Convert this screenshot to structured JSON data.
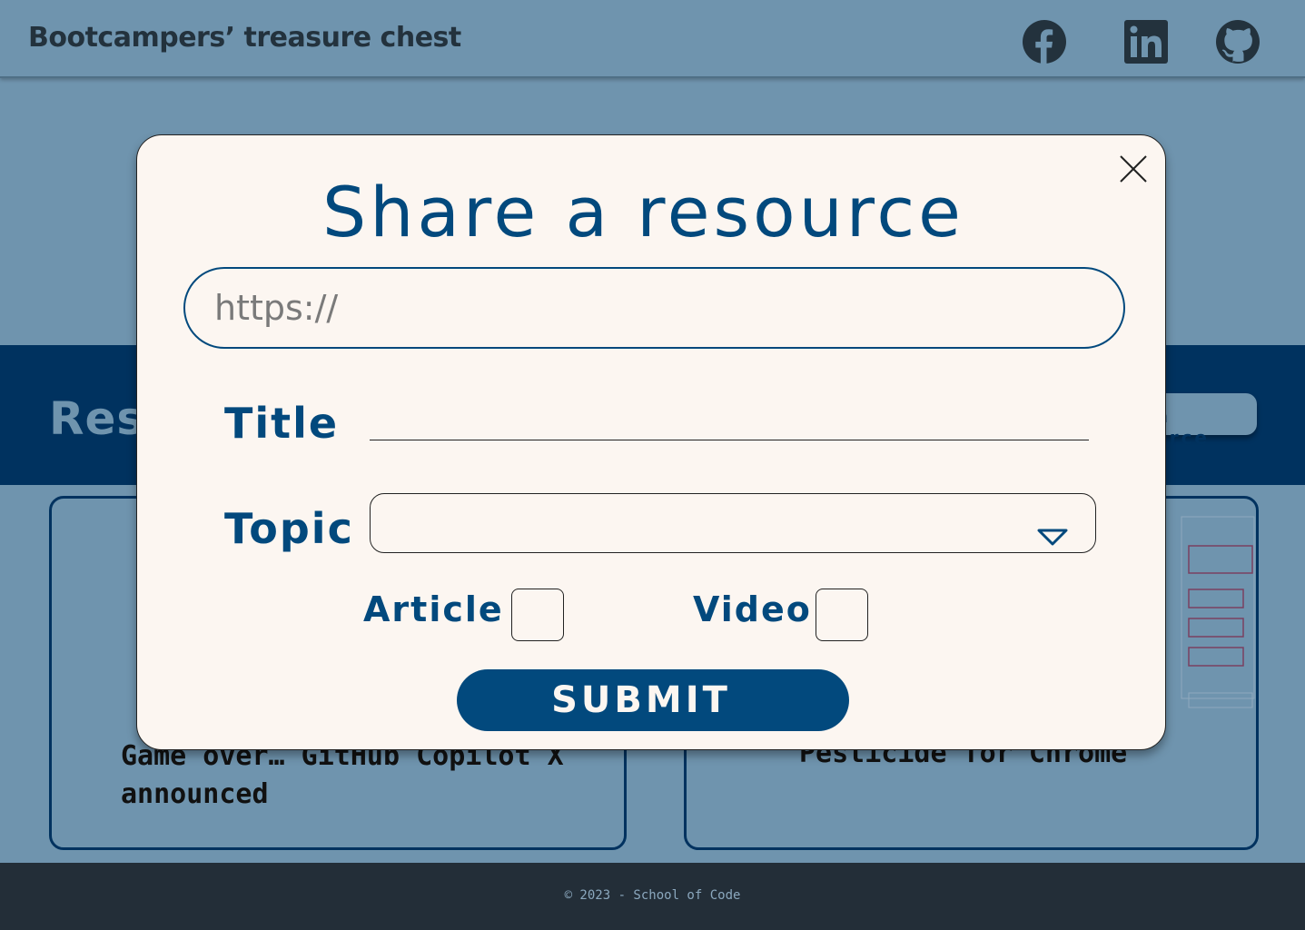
{
  "header": {
    "title": "Bootcampers’ treasure chest",
    "social_icons": [
      "facebook-icon",
      "linkedin-icon",
      "github-icon"
    ]
  },
  "resources": {
    "heading": "Resources",
    "add_button_label": "Add a resource"
  },
  "cards": [
    {
      "title": "Game over… GitHub Copilot X announced"
    },
    {
      "title": "Pesticide for Chrome"
    }
  ],
  "footer": {
    "text": "© 2023 - School of Code"
  },
  "modal": {
    "title": "Share a resource",
    "url_placeholder": "https://",
    "url_value": "",
    "title_label": "Title",
    "title_value": "",
    "topic_label": "Topic",
    "topic_value": "",
    "article_label": "Article",
    "article_checked": false,
    "video_label": "Video",
    "video_checked": false,
    "submit_label": "SUBMIT"
  },
  "colors": {
    "background": "#6f94ae",
    "brand_dark": "#00325f",
    "accent": "#02497d",
    "modal_bg": "#fcf6f1",
    "footer_bg": "#232e38"
  }
}
